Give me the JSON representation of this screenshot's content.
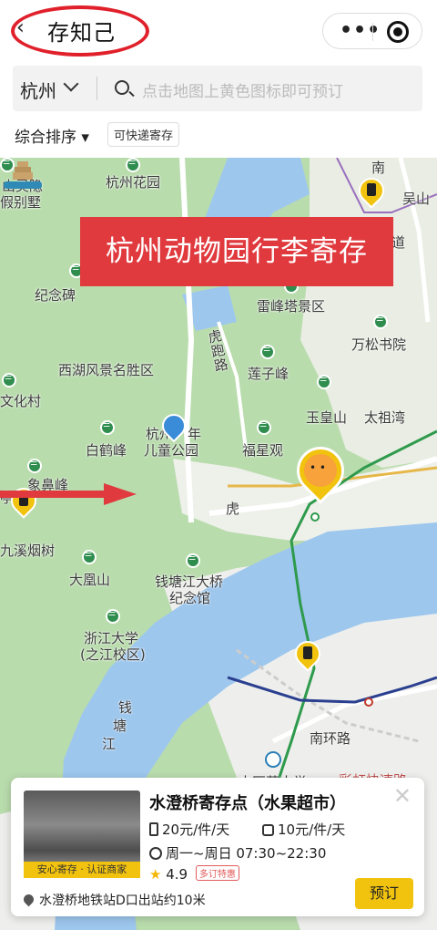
{
  "header": {
    "title": "存知己",
    "menu_dots": "•••"
  },
  "search": {
    "city": "杭州",
    "placeholder": "点击地图上黄色图标即可预订"
  },
  "filters": {
    "sort_label": "综合排序 ▾",
    "chip_label": "可快递寄存"
  },
  "banner": {
    "text": "杭州动物园行李寄存"
  },
  "map_labels": [
    "山灵隐",
    "假别墅",
    "杭州花园",
    "吴山",
    "道",
    "纪念碑",
    "雷峰塔景区",
    "西湖风景名胜区",
    "虎跑路",
    "万松书院",
    "莲子峰",
    "文化村",
    "玉皇山",
    "太祖湾",
    "杭州",
    "年",
    "儿童公园",
    "白鹤峰",
    "福星观",
    "亭",
    "象鼻峰",
    "虎",
    "九溪烟树",
    "大凰山",
    "钱塘江大桥",
    "纪念馆",
    "浙江大学",
    "(之江校区)",
    "钱",
    "塘",
    "江",
    "南环路",
    "中医药大学",
    "彩虹快速路",
    "南"
  ],
  "card": {
    "title": "水澄桥寄存点（水果超市）",
    "price_large": "20元/件/天",
    "price_small": "10元/件/天",
    "hours": "周一~周日 07:30~22:30",
    "rating": "4.9",
    "discount": "多订特惠",
    "thumb_tag": "安心寄存 · 认证商家",
    "location": "水澄桥地铁站D口出站约10米",
    "book_label": "预订",
    "close": "✕"
  },
  "colors": {
    "accent": "#f2c30e",
    "banner": "#e03a3e",
    "river": "#9ec7ee",
    "park": "#b9dcad"
  }
}
